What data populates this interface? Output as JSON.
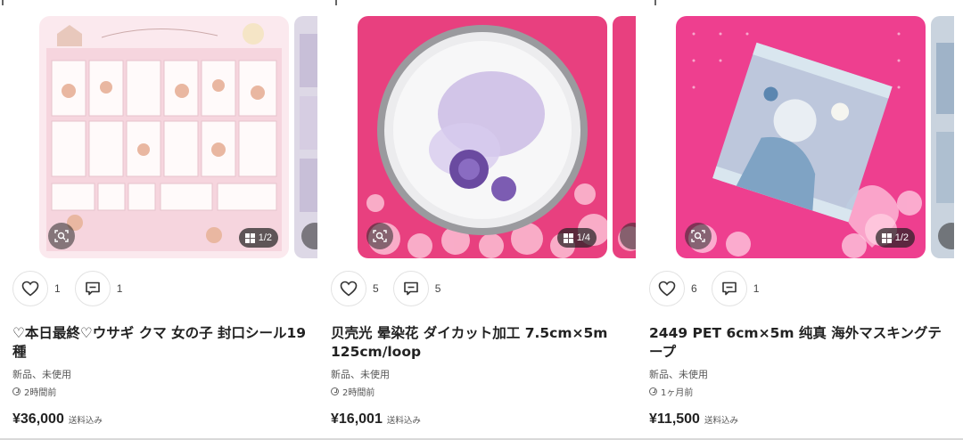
{
  "colors": {
    "accent_pink": "#ee3f8f",
    "text": "#222222"
  },
  "listings": [
    {
      "image_counter": "1/2",
      "likes": "1",
      "comments": "1",
      "title": "♡本日最終♡ウサギ クマ 女の子 封口シール19種",
      "condition": "新品、未使用",
      "posted": "2時間前",
      "price": "¥36,000",
      "shipping": "送料込み"
    },
    {
      "image_counter": "1/4",
      "likes": "5",
      "comments": "5",
      "title": "贝壳光 晕染花 ダイカット加工 7.5cm×5m 125cm/loop",
      "condition": "新品、未使用",
      "posted": "2時間前",
      "price": "¥16,001",
      "shipping": "送料込み"
    },
    {
      "image_counter": "1/2",
      "likes": "6",
      "comments": "1",
      "title": "2449 PET 6cm×5m 纯真 海外マスキングテープ",
      "condition": "新品、未使用",
      "posted": "1ヶ月前",
      "price": "¥11,500",
      "shipping": "送料込み"
    }
  ],
  "icons": {
    "like": "heart-icon",
    "comment": "comment-icon",
    "lens": "image-search-icon",
    "counter": "grid-icon",
    "time": "clock-icon"
  }
}
